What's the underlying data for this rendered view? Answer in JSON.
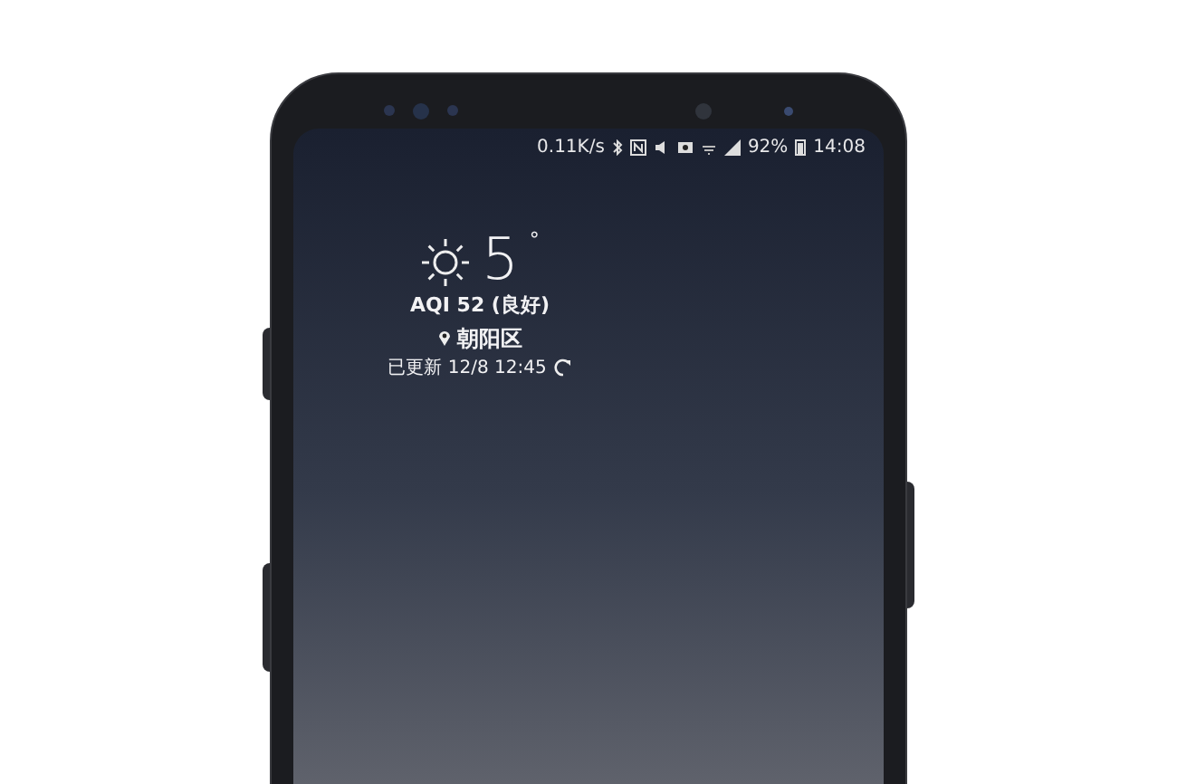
{
  "status_bar": {
    "network_speed": "0.11K/s",
    "battery": "92%",
    "time": "14:08"
  },
  "weather": {
    "temperature": "5",
    "degree_mark": "°",
    "aqi": "AQI 52 (良好)",
    "location": "朝阳区",
    "updated": "已更新 12/8 12:45"
  }
}
